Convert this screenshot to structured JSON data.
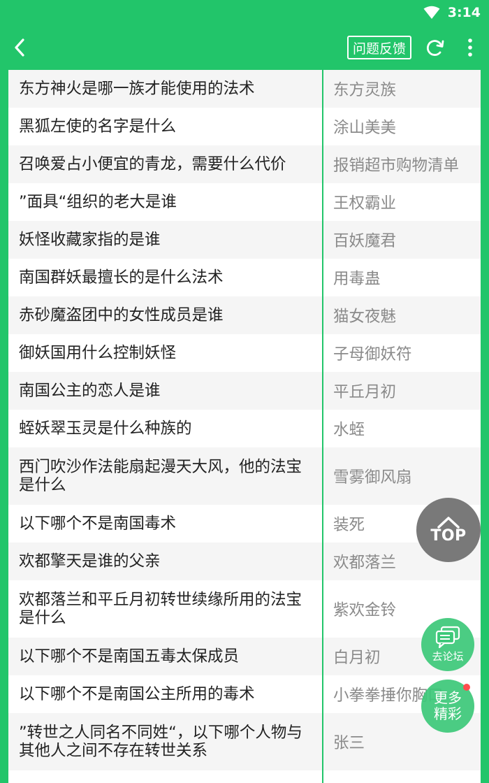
{
  "status": {
    "time": "3:14"
  },
  "header": {
    "feedback_label": "问题反馈"
  },
  "rows": [
    {
      "q": "东方神火是哪一族才能使用的法术",
      "a": "东方灵族"
    },
    {
      "q": "黑狐左使的名字是什么",
      "a": "涂山美美"
    },
    {
      "q": "召唤爱占小便宜的青龙，需要什么代价",
      "a": "报销超市购物清单"
    },
    {
      "q": "”面具“组织的老大是谁",
      "a": "王权霸业"
    },
    {
      "q": "妖怪收藏家指的是谁",
      "a": "百妖魔君"
    },
    {
      "q": "南国群妖最擅长的是什么法术",
      "a": "用毒蛊"
    },
    {
      "q": "赤砂魔盗团中的女性成员是谁",
      "a": "猫女夜魅"
    },
    {
      "q": "御妖国用什么控制妖怪",
      "a": "子母御妖符"
    },
    {
      "q": "南国公主的恋人是谁",
      "a": "平丘月初"
    },
    {
      "q": "蛭妖翠玉灵是什么种族的",
      "a": "水蛭"
    },
    {
      "q": "西门吹沙作法能扇起漫天大风，他的法宝是什么",
      "a": "雪雾御风扇"
    },
    {
      "q": "以下哪个不是南国毒术",
      "a": "装死"
    },
    {
      "q": "欢都擎天是谁的父亲",
      "a": "欢都落兰"
    },
    {
      "q": "欢都落兰和平丘月初转世续缘所用的法宝是什么",
      "a": "紫欢金铃"
    },
    {
      "q": "以下哪个不是南国五毒太保成员",
      "a": "白月初"
    },
    {
      "q": "以下哪个不是南国公主所用的毒术",
      "a": "小拳拳捶你胸口"
    },
    {
      "q": "”转世之人同名不同姓“，以下哪个人物与其他人之间不存在转世关系",
      "a": "张三"
    }
  ],
  "fab": {
    "top_label": "TOP",
    "forum_label": "去论坛",
    "more_label": "更多精彩"
  },
  "colors": {
    "accent": "#22c56a",
    "fab_gray": "#6e6e6e",
    "badge": "#ff4d4d"
  }
}
